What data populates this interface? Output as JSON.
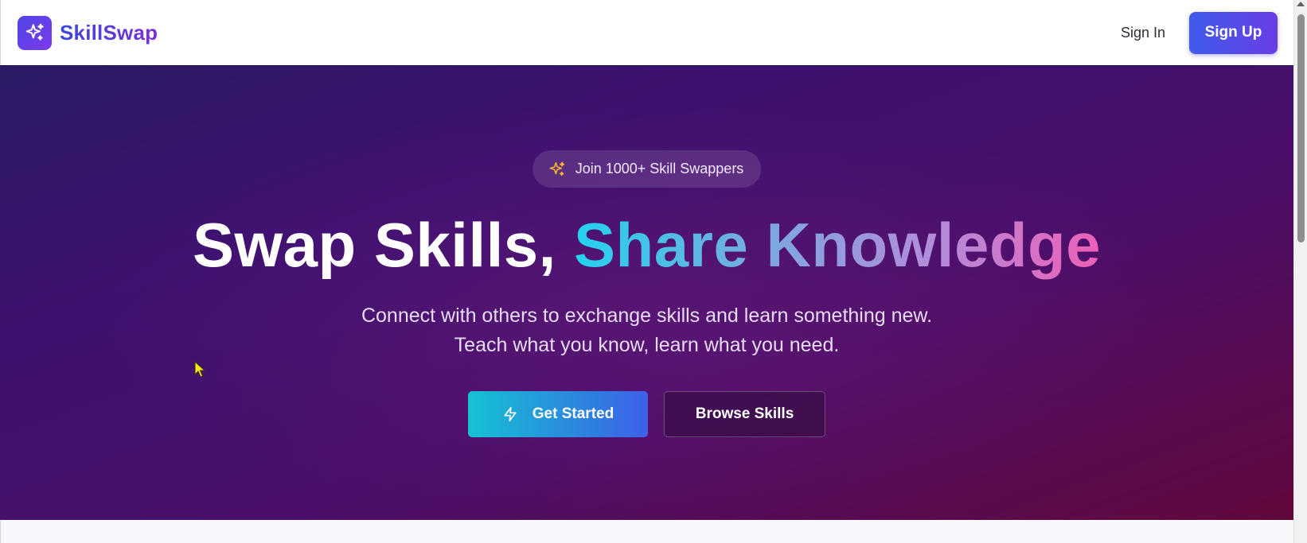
{
  "header": {
    "brand_name": "SkillSwap",
    "brand_icon": "sparkles-icon",
    "signin_label": "Sign In",
    "signup_label": "Sign Up"
  },
  "hero": {
    "badge_icon": "sparkles-icon",
    "badge_text": "Join 1000+ Skill Swappers",
    "headline_white": "Swap Skills, ",
    "headline_gradient": "Share Knowledge",
    "subtitle_line1": "Connect with others to exchange skills and learn something new.",
    "subtitle_line2": "Teach what you know, learn what you need.",
    "primary_cta": {
      "label": "Get Started",
      "icon": "lightning-icon"
    },
    "secondary_cta": {
      "label": "Browse Skills"
    }
  },
  "colors": {
    "brand_gradient_start": "#3b47d8",
    "brand_gradient_end": "#7c2fd8",
    "hero_bg_start": "#2b1a66",
    "hero_bg_end": "#62073a",
    "cta_gradient_start": "#16c1d3",
    "cta_gradient_end": "#3f5feb",
    "badge_icon_color": "#f5b62a"
  }
}
